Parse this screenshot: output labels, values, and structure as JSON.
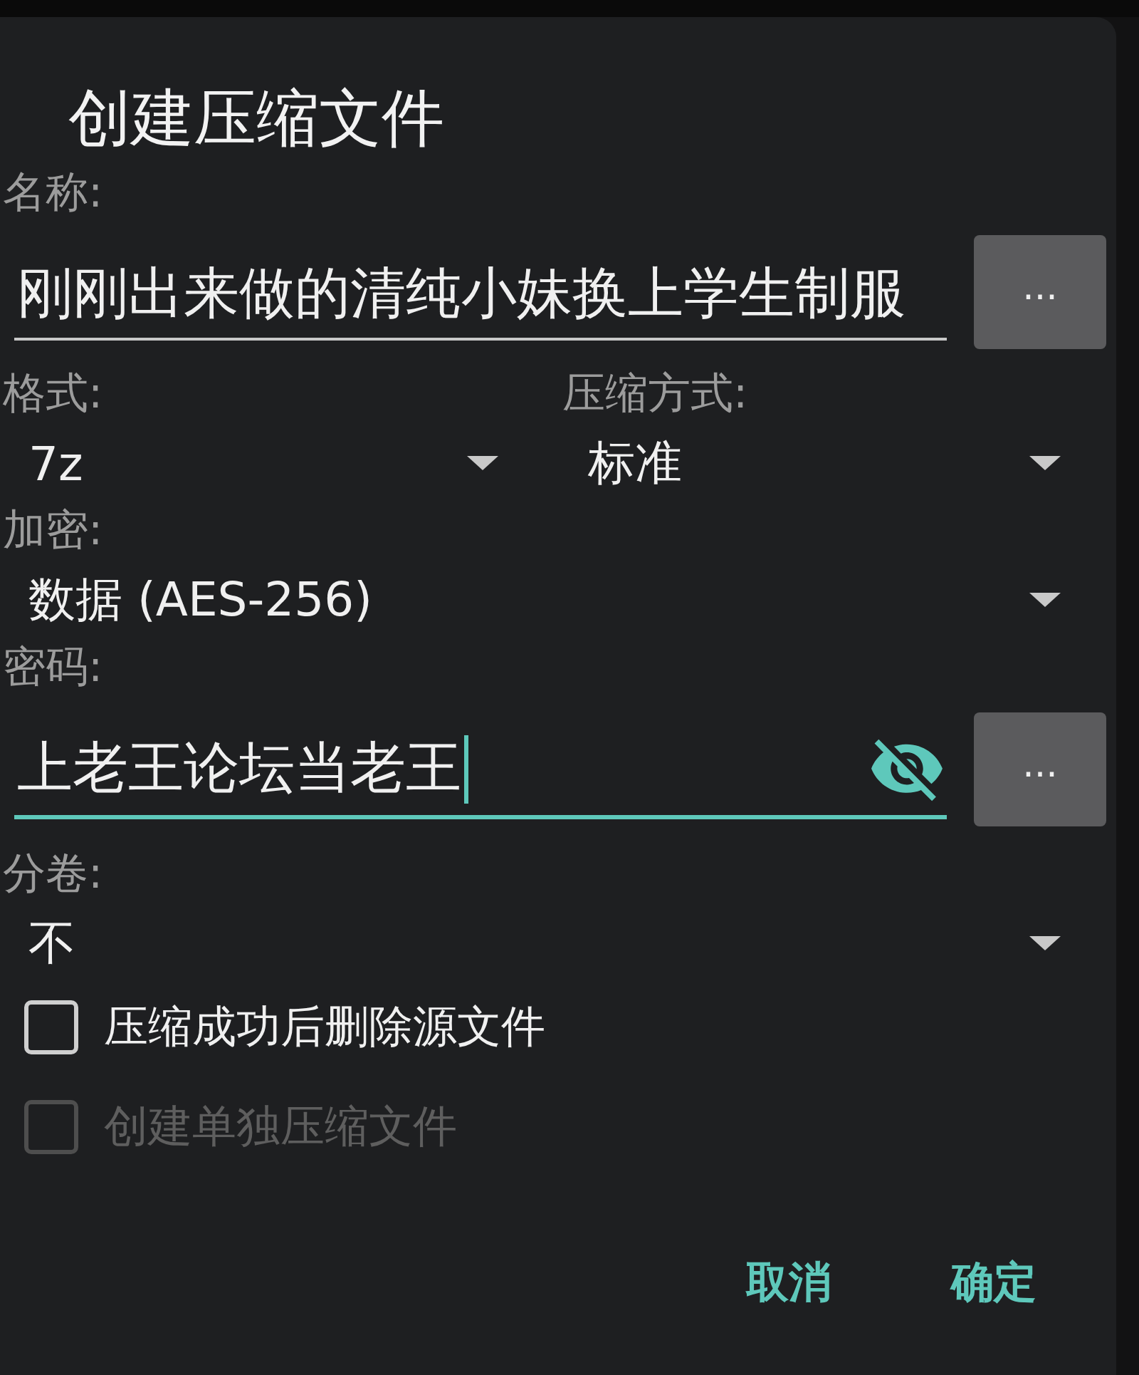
{
  "dialog": {
    "title": "创建压缩文件",
    "name": {
      "label": "名称:",
      "value": "刚刚出来做的清纯小妹换上学生制服",
      "focused": false,
      "button": "..."
    },
    "format": {
      "label": "格式:",
      "value": "7z"
    },
    "compression": {
      "label": "压缩方式:",
      "value": "标准"
    },
    "encryption": {
      "label": "加密:",
      "value": "数据 (AES-256)"
    },
    "password": {
      "label": "密码:",
      "value": "上老王论坛当老王",
      "focused": true,
      "button": "..."
    },
    "split": {
      "label": "分卷:",
      "value": "不"
    },
    "options": [
      {
        "label": "压缩成功后删除源文件",
        "checked": false,
        "disabled": false
      },
      {
        "label": "创建单独压缩文件",
        "checked": false,
        "disabled": true
      }
    ],
    "buttons": [
      "取消",
      "确定"
    ]
  }
}
